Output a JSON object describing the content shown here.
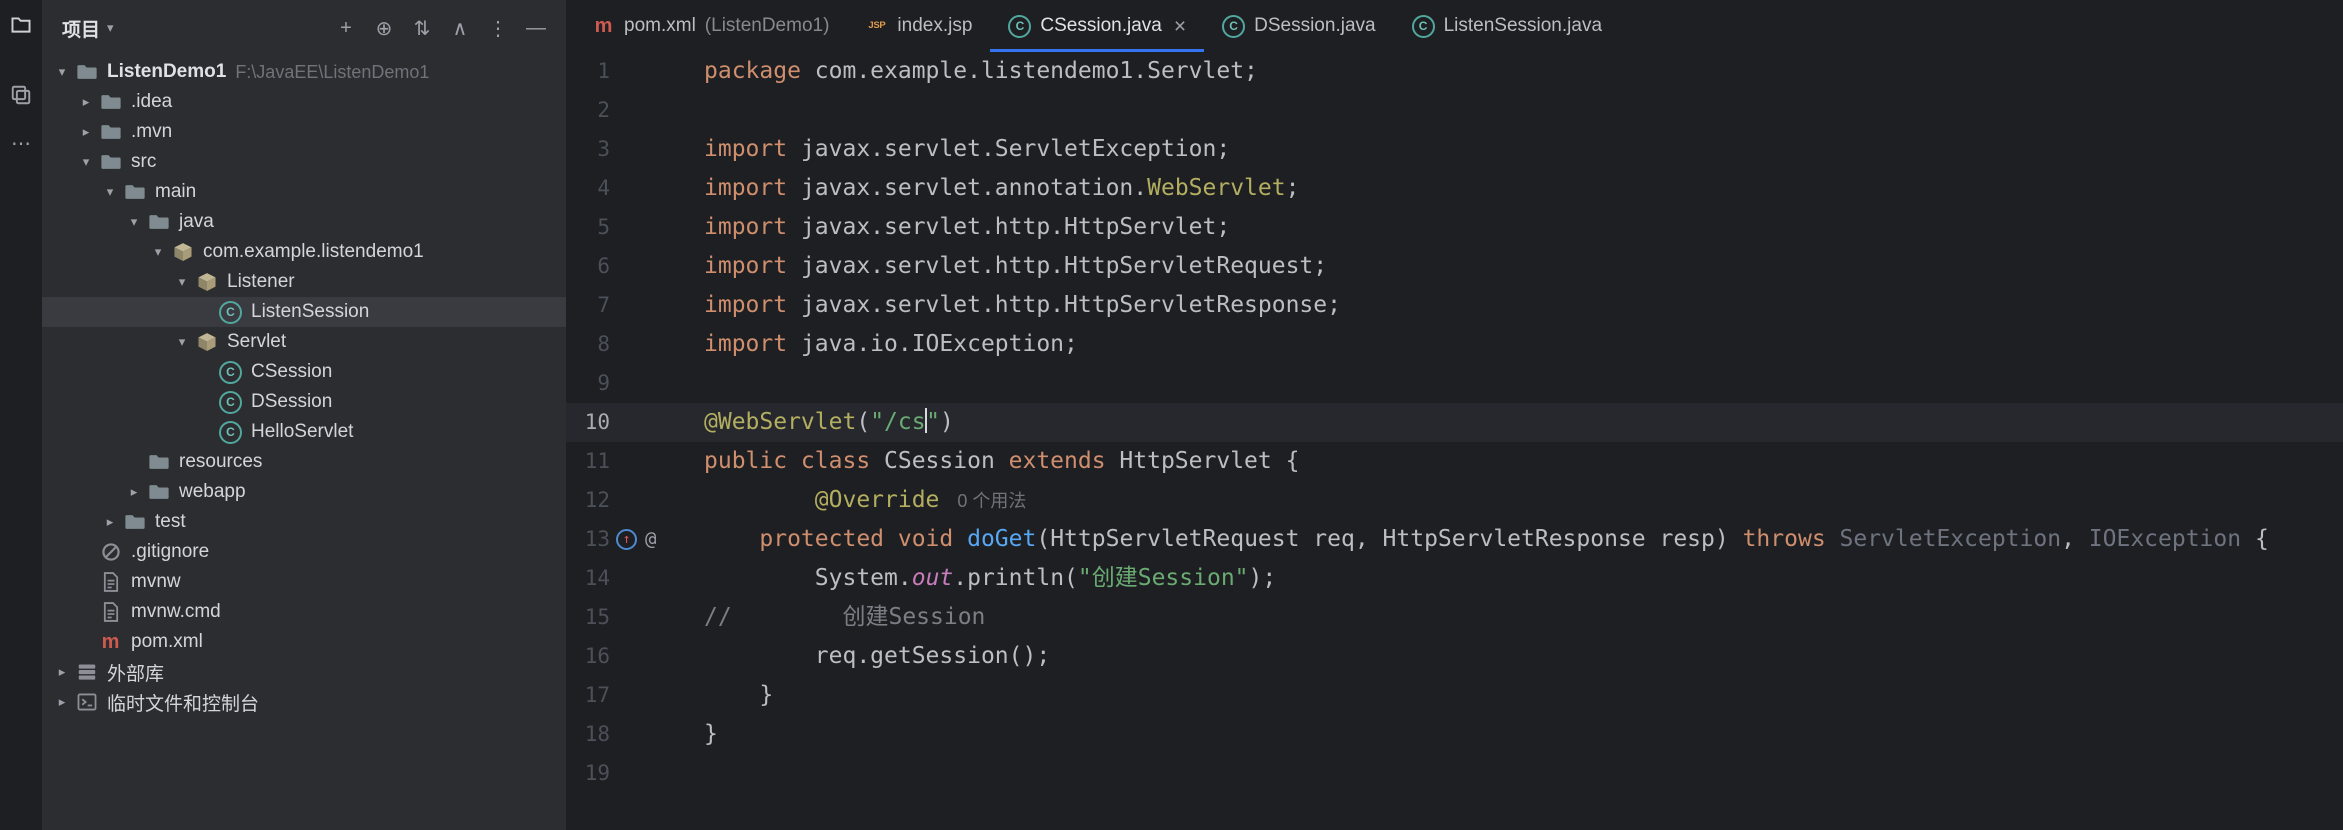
{
  "activity_bar": {
    "icons": [
      {
        "name": "project-folder",
        "active": true
      },
      {
        "name": "copy",
        "active": false
      },
      {
        "name": "more",
        "active": false
      }
    ]
  },
  "project_panel": {
    "header": {
      "title": "项目",
      "toolbar": [
        {
          "name": "plus"
        },
        {
          "name": "locate"
        },
        {
          "name": "expand"
        },
        {
          "name": "collapse"
        },
        {
          "name": "more-vertical"
        },
        {
          "name": "hide"
        }
      ]
    },
    "tree": [
      {
        "label": "ListenDemo1",
        "suffix": "F:\\JavaEE\\ListenDemo1",
        "level": 0,
        "chevron": "open",
        "icon": "folder",
        "bold": true
      },
      {
        "label": ".idea",
        "level": 1,
        "chevron": "closed",
        "icon": "folder"
      },
      {
        "label": ".mvn",
        "level": 1,
        "chevron": "closed",
        "icon": "folder"
      },
      {
        "label": "src",
        "level": 1,
        "chevron": "open",
        "icon": "folder"
      },
      {
        "label": "main",
        "level": 2,
        "chevron": "open",
        "icon": "folder"
      },
      {
        "label": "java",
        "level": 3,
        "chevron": "open",
        "icon": "folder"
      },
      {
        "label": "com.example.listendemo1",
        "level": 4,
        "chevron": "open",
        "icon": "package"
      },
      {
        "label": "Listener",
        "level": 5,
        "chevron": "open",
        "icon": "package"
      },
      {
        "label": "ListenSession",
        "level": 6,
        "chevron": "none",
        "icon": "class",
        "selected": true
      },
      {
        "label": "Servlet",
        "level": 5,
        "chevron": "open",
        "icon": "package"
      },
      {
        "label": "CSession",
        "level": 6,
        "chevron": "none",
        "icon": "class"
      },
      {
        "label": "DSession",
        "level": 6,
        "chevron": "none",
        "icon": "class"
      },
      {
        "label": "HelloServlet",
        "level": 6,
        "chevron": "none",
        "icon": "class"
      },
      {
        "label": "resources",
        "level": 3,
        "chevron": "none",
        "icon": "folder"
      },
      {
        "label": "webapp",
        "level": 3,
        "chevron": "closed",
        "icon": "folder"
      },
      {
        "label": "test",
        "level": 2,
        "chevron": "closed",
        "icon": "folder"
      },
      {
        "label": ".gitignore",
        "level": 1,
        "chevron": "none",
        "icon": "ignore"
      },
      {
        "label": "mvnw",
        "level": 1,
        "chevron": "none",
        "icon": "file"
      },
      {
        "label": "mvnw.cmd",
        "level": 1,
        "chevron": "none",
        "icon": "file"
      },
      {
        "label": "pom.xml",
        "level": 1,
        "chevron": "none",
        "icon": "maven"
      },
      {
        "label": "外部库",
        "level": 0,
        "chevron": "closed",
        "icon": "library"
      },
      {
        "label": "临时文件和控制台",
        "level": 0,
        "chevron": "closed",
        "icon": "scratch"
      }
    ]
  },
  "tabs": {
    "close_glyph": "×",
    "items": [
      {
        "label": "pom.xml",
        "suffix": " (ListenDemo1)",
        "icon": "maven",
        "active": false,
        "closable": false
      },
      {
        "label": "index.jsp",
        "suffix": "",
        "icon": "jsp",
        "active": false,
        "closable": false
      },
      {
        "label": "CSession.java",
        "suffix": "",
        "icon": "class",
        "active": true,
        "closable": true
      },
      {
        "label": "DSession.java",
        "suffix": "",
        "icon": "class",
        "active": false,
        "closable": false
      },
      {
        "label": "ListenSession.java",
        "suffix": "",
        "icon": "class",
        "active": false,
        "closable": false
      }
    ]
  },
  "editor": {
    "current_line": 10,
    "lines": [
      {
        "n": 1,
        "tk": [
          [
            "kw",
            "package "
          ],
          [
            "d",
            "com.example.listendemo1.Servlet;"
          ]
        ]
      },
      {
        "n": 2,
        "tk": []
      },
      {
        "n": 3,
        "tk": [
          [
            "kw",
            "import "
          ],
          [
            "d",
            "javax.servlet.ServletException;"
          ]
        ]
      },
      {
        "n": 4,
        "tk": [
          [
            "kw",
            "import "
          ],
          [
            "d",
            "javax.servlet.annotation."
          ],
          [
            "ann",
            "WebServlet"
          ],
          [
            "d",
            ";"
          ]
        ]
      },
      {
        "n": 5,
        "tk": [
          [
            "kw",
            "import "
          ],
          [
            "d",
            "javax.servlet.http.HttpServlet;"
          ]
        ]
      },
      {
        "n": 6,
        "tk": [
          [
            "kw",
            "import "
          ],
          [
            "d",
            "javax.servlet.http.HttpServletRequest;"
          ]
        ]
      },
      {
        "n": 7,
        "tk": [
          [
            "kw",
            "import "
          ],
          [
            "d",
            "javax.servlet.http.HttpServletResponse;"
          ]
        ]
      },
      {
        "n": 8,
        "tk": [
          [
            "kw",
            "import "
          ],
          [
            "d",
            "java.io.IOException;"
          ]
        ]
      },
      {
        "n": 9,
        "tk": []
      },
      {
        "n": 10,
        "tk": [
          [
            "ann",
            "@WebServlet"
          ],
          [
            "d",
            "("
          ],
          [
            "str",
            "\"/cs"
          ],
          [
            "caret",
            ""
          ],
          [
            "str",
            "\""
          ],
          [
            "d",
            ")"
          ]
        ]
      },
      {
        "n": 11,
        "tk": [
          [
            "kw",
            "public class "
          ],
          [
            "d",
            "CSession "
          ],
          [
            "kw",
            "extends "
          ],
          [
            "d",
            "HttpServlet {"
          ]
        ]
      },
      {
        "n": 12,
        "tk": [
          [
            "d",
            "        "
          ],
          [
            "ann",
            "@Override"
          ],
          [
            "inlay",
            "0 个用法"
          ]
        ]
      },
      {
        "n": 13,
        "gutter": [
          "override",
          "annotation"
        ],
        "tk": [
          [
            "d",
            "    "
          ],
          [
            "kw",
            "protected void "
          ],
          [
            "meth",
            "doGet"
          ],
          [
            "d",
            "(HttpServletRequest req, HttpServletResponse resp) "
          ],
          [
            "kw",
            "throws "
          ],
          [
            "dim",
            "ServletException"
          ],
          [
            "d",
            ", "
          ],
          [
            "dim",
            "IOException"
          ],
          [
            "d",
            " {"
          ]
        ]
      },
      {
        "n": 14,
        "tk": [
          [
            "d",
            "        System."
          ],
          [
            "field",
            "out"
          ],
          [
            "d",
            ".println("
          ],
          [
            "str",
            "\"创建Session\""
          ],
          [
            "d",
            ");"
          ]
        ]
      },
      {
        "n": 15,
        "tk": [
          [
            "com",
            "//        创建Session"
          ]
        ]
      },
      {
        "n": 16,
        "tk": [
          [
            "d",
            "        req.getSession();"
          ]
        ]
      },
      {
        "n": 17,
        "tk": [
          [
            "d",
            "    }"
          ]
        ]
      },
      {
        "n": 18,
        "tk": [
          [
            "d",
            "}"
          ]
        ]
      },
      {
        "n": 19,
        "tk": []
      }
    ]
  }
}
